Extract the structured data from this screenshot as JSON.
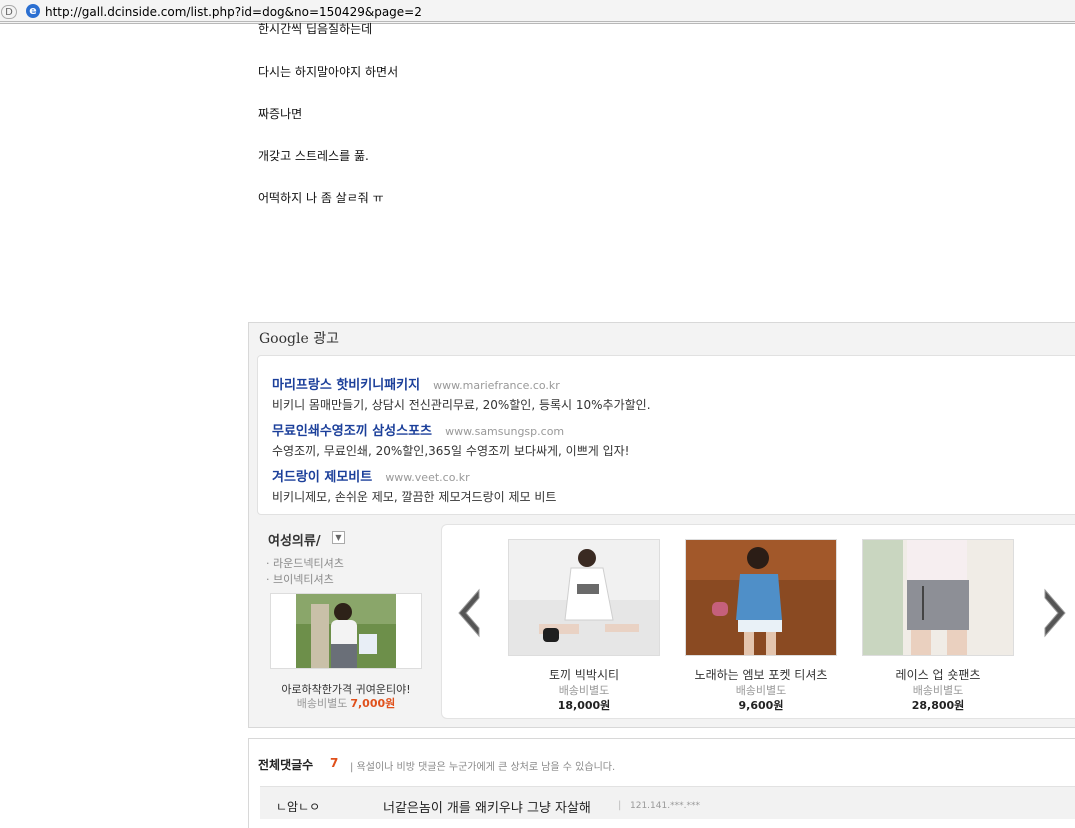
{
  "address_bar": {
    "mode_label": "D",
    "url": "http://gall.dcinside.com/list.php?id=dog&no=150429&page=2"
  },
  "post": {
    "lines": [
      "한시간씩 딥음질하는데",
      "다시는 하지말아야지 하면서",
      "짜증나면",
      "개갖고 스트레스를 풂.",
      "어떡하지 나 좀 살ㄹ줘 ㅠ"
    ]
  },
  "google_ad": {
    "brand": "Google",
    "label": "광고",
    "items": [
      {
        "title": "마리프랑스 핫비키니패키지",
        "url": "www.mariefrance.co.kr",
        "desc": "비키니 몸매만들기, 상담시 전신관리무료, 20%할인, 등록시 10%추가할인."
      },
      {
        "title": "무료인쇄수영조끼 삼성스포츠",
        "url": "www.samsungsp.com",
        "desc": "수영조끼, 무료인쇄, 20%할인,365일 수영조끼 보다싸게, 이쁘게 입자!"
      },
      {
        "title": "겨드랑이 제모비트",
        "url": "www.veet.co.kr",
        "desc": "비키니제모, 손쉬운 제모, 깔끔한 제모겨드랑이 제모 비트"
      }
    ]
  },
  "shopping": {
    "category_title": "여성의류/",
    "subcategories": [
      "라운드넥티셔츠",
      "브이넥티셔츠"
    ],
    "featured": {
      "caption": "아로하착한가격 귀여운티야!",
      "shipping": "배송비별도",
      "price": "7,000원"
    },
    "products": [
      {
        "name": "토끼 빅박시티",
        "shipping": "배송비별도",
        "price": "18,000원"
      },
      {
        "name": "노래하는 엠보 포켓 티셔츠",
        "shipping": "배송비별도",
        "price": "9,600원"
      },
      {
        "name": "레이스 업 숏팬츠",
        "shipping": "배송비별도",
        "price": "28,800원"
      }
    ]
  },
  "comments": {
    "title": "전체댓글수",
    "count": "7",
    "notice": "| 욕설이나 비방 댓글은 누군가에게 큰 상처로 남을 수 있습니다.",
    "items": [
      {
        "author": "ㄴ암ㄴㅇ",
        "text": "너같은놈이 개를 왜키우냐 그냥 자살해",
        "separator": "|",
        "ip": "121.141.***.***"
      }
    ]
  },
  "colors": {
    "link_blue": "#1b3f9a",
    "price_orange": "#e0501b",
    "panel_gray": "#f3f3f3"
  }
}
